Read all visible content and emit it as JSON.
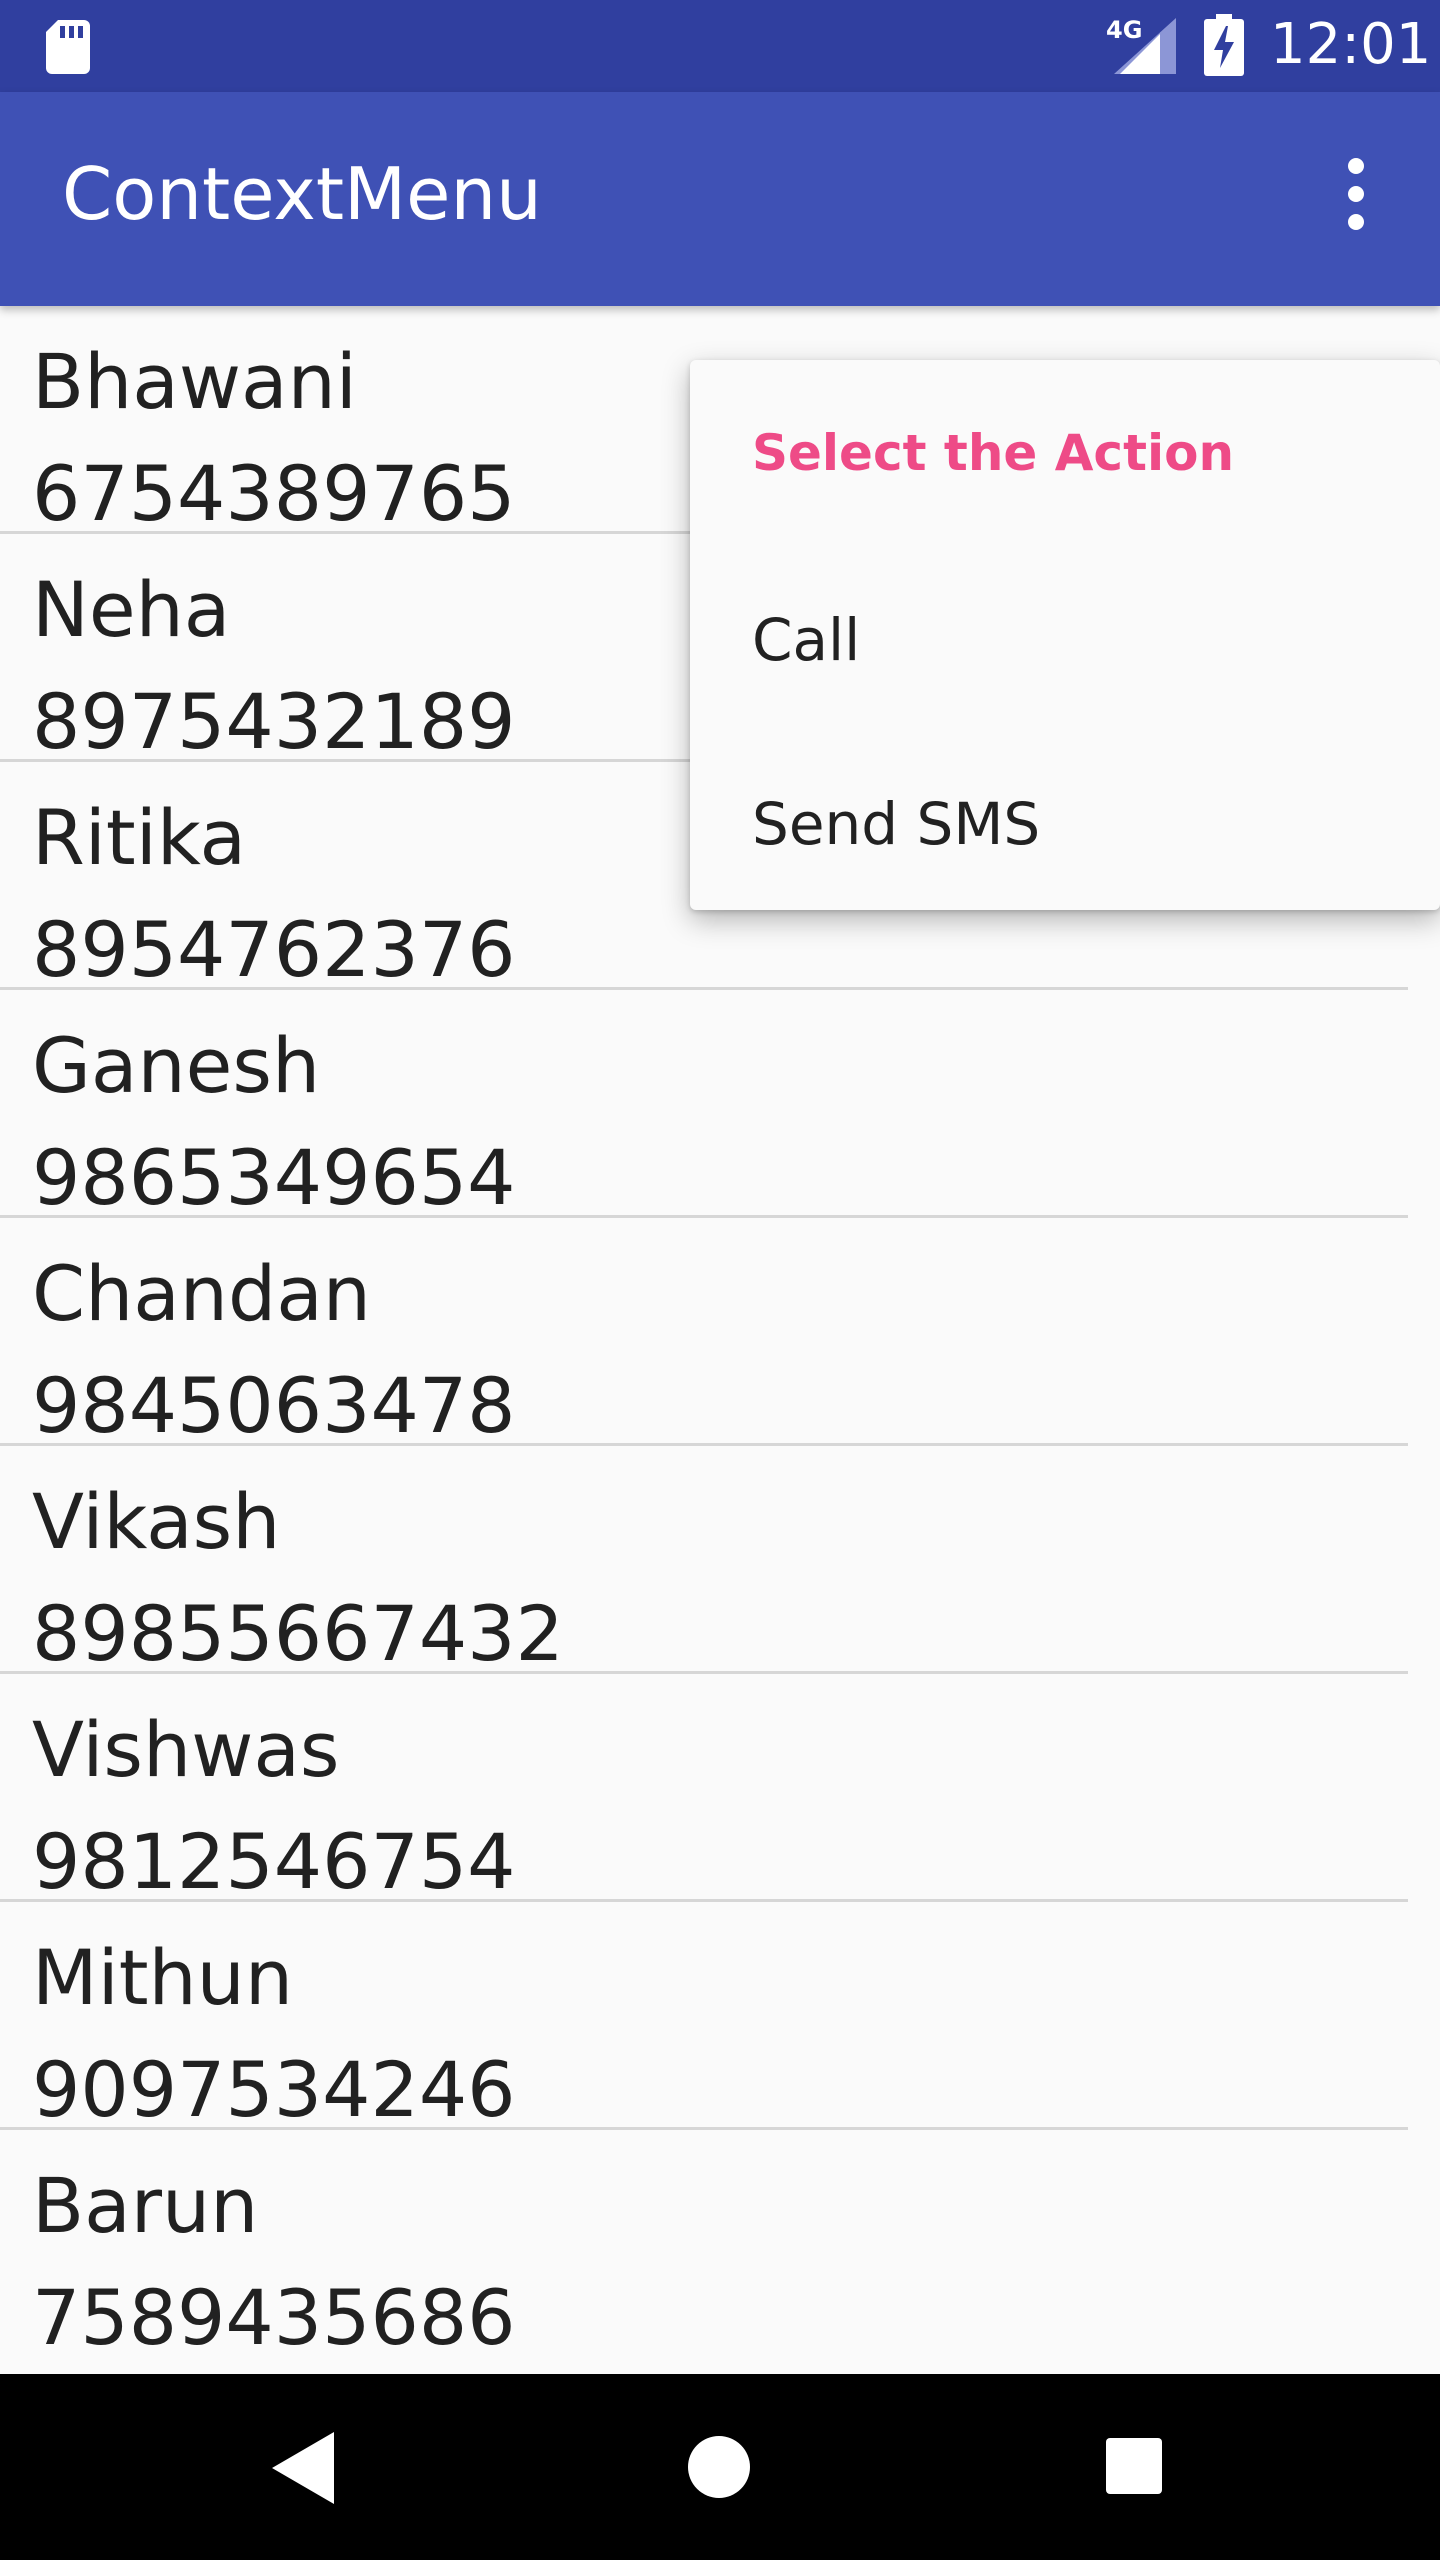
{
  "status_bar": {
    "network": "4G",
    "time": "12:01"
  },
  "app_bar": {
    "title": "ContextMenu"
  },
  "contacts": [
    {
      "name": "Bhawani",
      "phone": "6754389765"
    },
    {
      "name": "Neha",
      "phone": "8975432189"
    },
    {
      "name": "Ritika",
      "phone": "8954762376"
    },
    {
      "name": "Ganesh",
      "phone": "9865349654"
    },
    {
      "name": "Chandan",
      "phone": "9845063478"
    },
    {
      "name": "Vikash",
      "phone": "89855667432"
    },
    {
      "name": "Vishwas",
      "phone": "9812546754"
    },
    {
      "name": "Mithun",
      "phone": "9097534246"
    },
    {
      "name": "Barun",
      "phone": "7589435686"
    }
  ],
  "context_menu": {
    "header": "Select the Action",
    "items": [
      {
        "label": "Call"
      },
      {
        "label": "Send SMS"
      }
    ]
  },
  "colors": {
    "status_bar": "#303f9f",
    "app_bar": "#3f51b5",
    "accent": "#ee4b87",
    "background": "#fafafa"
  }
}
